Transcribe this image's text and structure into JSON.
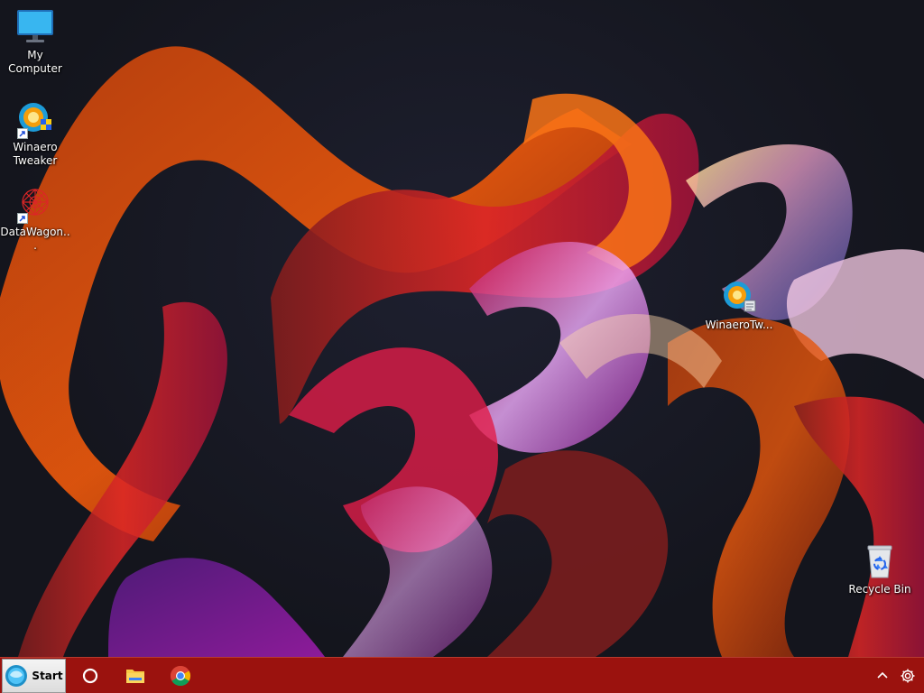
{
  "desktop": {
    "icons": [
      {
        "label": "My Computer",
        "icon": "monitor-icon"
      },
      {
        "label": "Winaero Tweaker",
        "icon": "winaero-tweaker-icon",
        "shortcut": true
      },
      {
        "label": "DataWagon...",
        "icon": "datawagon-icon",
        "shortcut": true
      },
      {
        "label": "WinaeroTw...",
        "icon": "winaero-tweaker-icon"
      },
      {
        "label": "Recycle Bin",
        "icon": "recycle-bin-icon"
      }
    ]
  },
  "taskbar": {
    "background": "#9b120e",
    "start": {
      "label": "Start",
      "icon": "start-orb-icon"
    },
    "pinned": [
      {
        "name": "search",
        "icon": "cortana-circle-icon"
      },
      {
        "name": "file-explorer",
        "icon": "folder-icon"
      },
      {
        "name": "chrome",
        "icon": "chrome-icon"
      }
    ],
    "tray": [
      {
        "name": "show-hidden-icons",
        "icon": "chevron-up-icon"
      },
      {
        "name": "settings",
        "icon": "gear-icon"
      }
    ]
  }
}
